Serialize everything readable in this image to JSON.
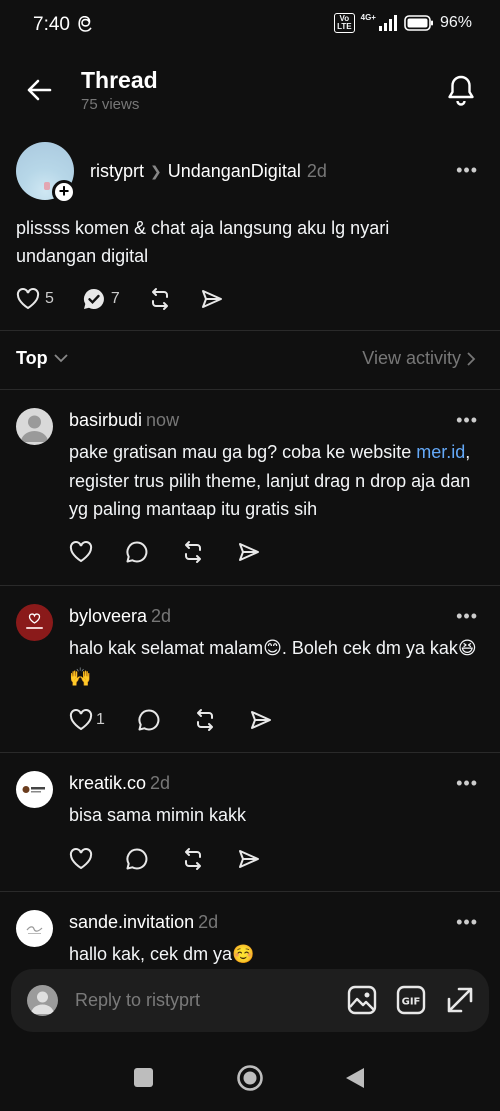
{
  "status": {
    "time": "7:40",
    "volte": "Vo LTE",
    "network": "4G+",
    "battery": "96%"
  },
  "header": {
    "title": "Thread",
    "views": "75 views"
  },
  "post": {
    "username": "ristyprt",
    "community": "UndanganDigital",
    "time": "2d",
    "text": "plissss komen & chat aja langsung aku lg nyari undangan digital",
    "likes": "5",
    "replies": "7"
  },
  "sort": {
    "label": "Top",
    "view_activity": "View activity"
  },
  "replies": [
    {
      "username": "basirbudi",
      "time": "now",
      "text_before": "pake gratisan mau ga bg? coba ke website ",
      "link": "mer.id",
      "text_after": ", register trus pilih theme, lanjut drag n drop aja dan yg paling mantaap itu gratis sih",
      "likes": ""
    },
    {
      "username": "byloveera",
      "time": "2d",
      "text": "halo kak selamat malam😊. Boleh cek dm ya kak😆🙌",
      "likes": "1",
      "avatar_text": "LOVEERA"
    },
    {
      "username": "kreatik.co",
      "time": "2d",
      "text": "bisa sama mimin kakk",
      "likes": ""
    },
    {
      "username": "sande.invitation",
      "time": "2d",
      "text": "hallo kak, cek dm ya☺️",
      "likes": ""
    }
  ],
  "composer": {
    "placeholder": "Reply to ristyprt",
    "gif_label": "GIF"
  },
  "colors": {
    "background": "#101010",
    "link": "#64a9f8",
    "muted": "#777777",
    "composer_bg": "#1e1e1e"
  }
}
